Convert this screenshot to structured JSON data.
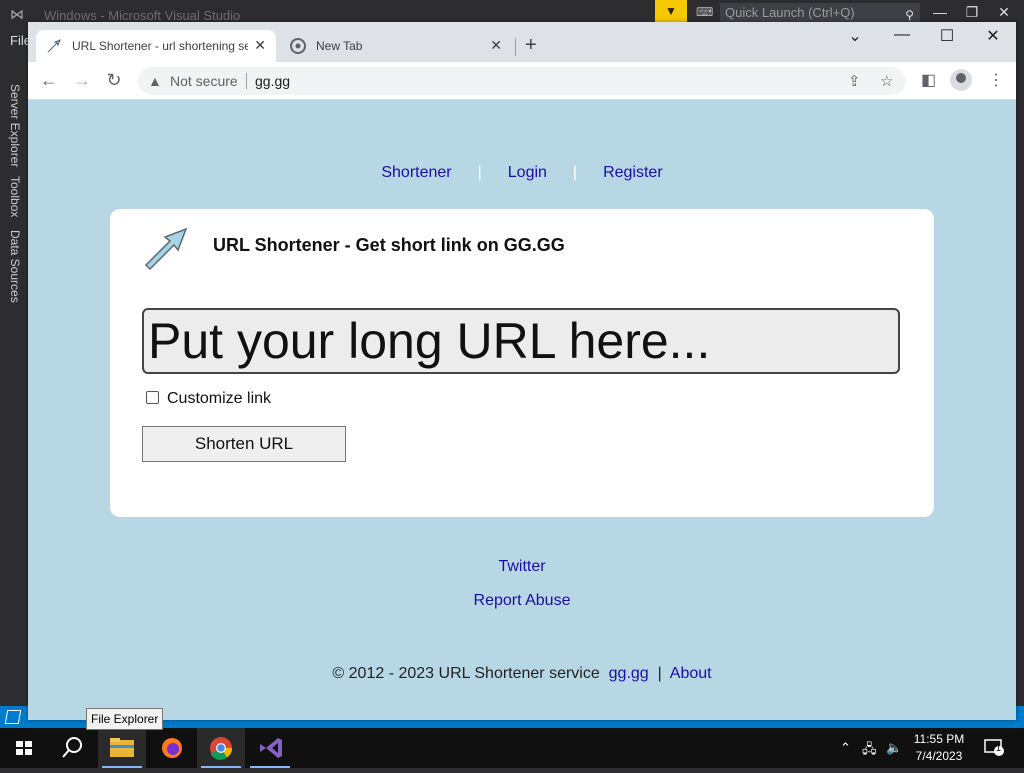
{
  "vs": {
    "title": "Windows - Microsoft Visual Studio",
    "quick_launch": "Quick Launch (Ctrl+Q)",
    "menu_file": "File",
    "side_tabs": [
      "Server Explorer",
      "Toolbox",
      "Data Sources"
    ],
    "tooltip": "File Explorer"
  },
  "browser": {
    "tabs": [
      {
        "label": "URL Shortener - url shortening service"
      },
      {
        "label": "New Tab"
      }
    ],
    "security_label": "Not secure",
    "address": "gg.gg"
  },
  "page": {
    "nav": [
      "Shortener",
      "Login",
      "Register"
    ],
    "nav_sep": "|",
    "heading": "URL Shortener - Get short link on GG.GG",
    "url_placeholder": "Put your long URL here...",
    "customize_label": "Customize link",
    "shorten_button": "Shorten URL",
    "twitter_link": "Twitter",
    "report_link": "Report Abuse",
    "copyright": "© 2012 - 2023 URL Shortener service",
    "footer_site": "gg.gg",
    "footer_sep": "|",
    "footer_about": "About"
  },
  "taskbar": {
    "time": "11:55 PM",
    "date": "7/4/2023",
    "notification_count": "1"
  },
  "colors": {
    "page_bg": "#b8d7e4",
    "link": "#1a0dab",
    "vs_status": "#007acc"
  }
}
